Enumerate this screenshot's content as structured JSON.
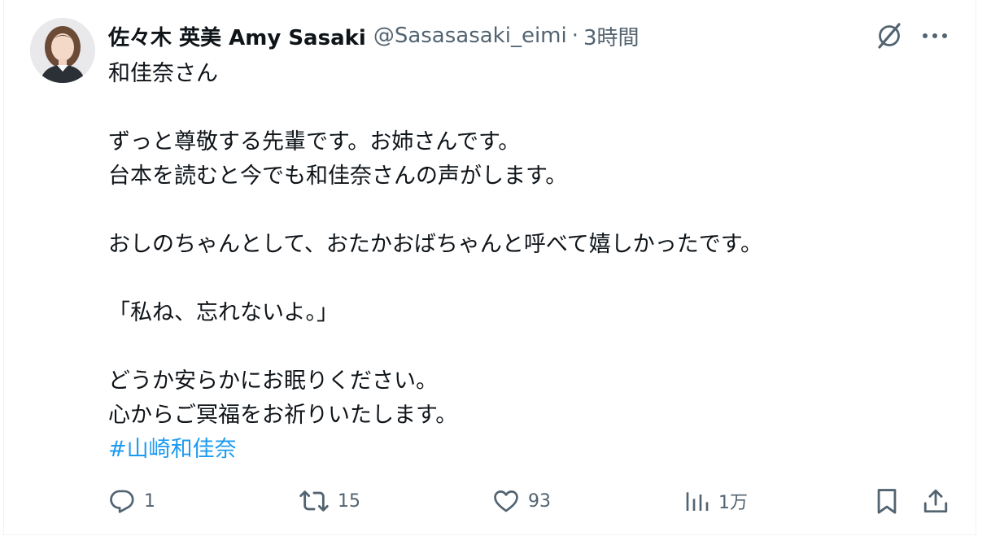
{
  "tweet": {
    "author": {
      "display_name": "佐々木 英美 Amy Sasaki",
      "handle": "@Sasasasaki_eimi",
      "separator": "·",
      "time": "3時間"
    },
    "body_lines": [
      "和佳奈さん",
      "",
      "ずっと尊敬する先輩です。お姉さんです。",
      "台本を読むと今でも和佳奈さんの声がします。",
      "",
      "おしのちゃんとして、おたかおばちゃんと呼べて嬉しかったです。",
      "",
      "「私ね、忘れないよ。」",
      "",
      "どうか安らかにお眠りください。",
      "心からご冥福をお祈りいたします。"
    ],
    "hashtag": "#山崎和佳奈",
    "actions": {
      "reply": {
        "icon": "reply-icon",
        "count": "1"
      },
      "retweet": {
        "icon": "retweet-icon",
        "count": "15"
      },
      "like": {
        "icon": "heart-icon",
        "count": "93"
      },
      "views": {
        "icon": "views-icon",
        "count": "1万"
      },
      "bookmark": {
        "icon": "bookmark-icon"
      },
      "share": {
        "icon": "share-icon"
      }
    },
    "colors": {
      "text": "#0f1419",
      "secondary": "#536471",
      "link": "#1d9bf0"
    }
  }
}
